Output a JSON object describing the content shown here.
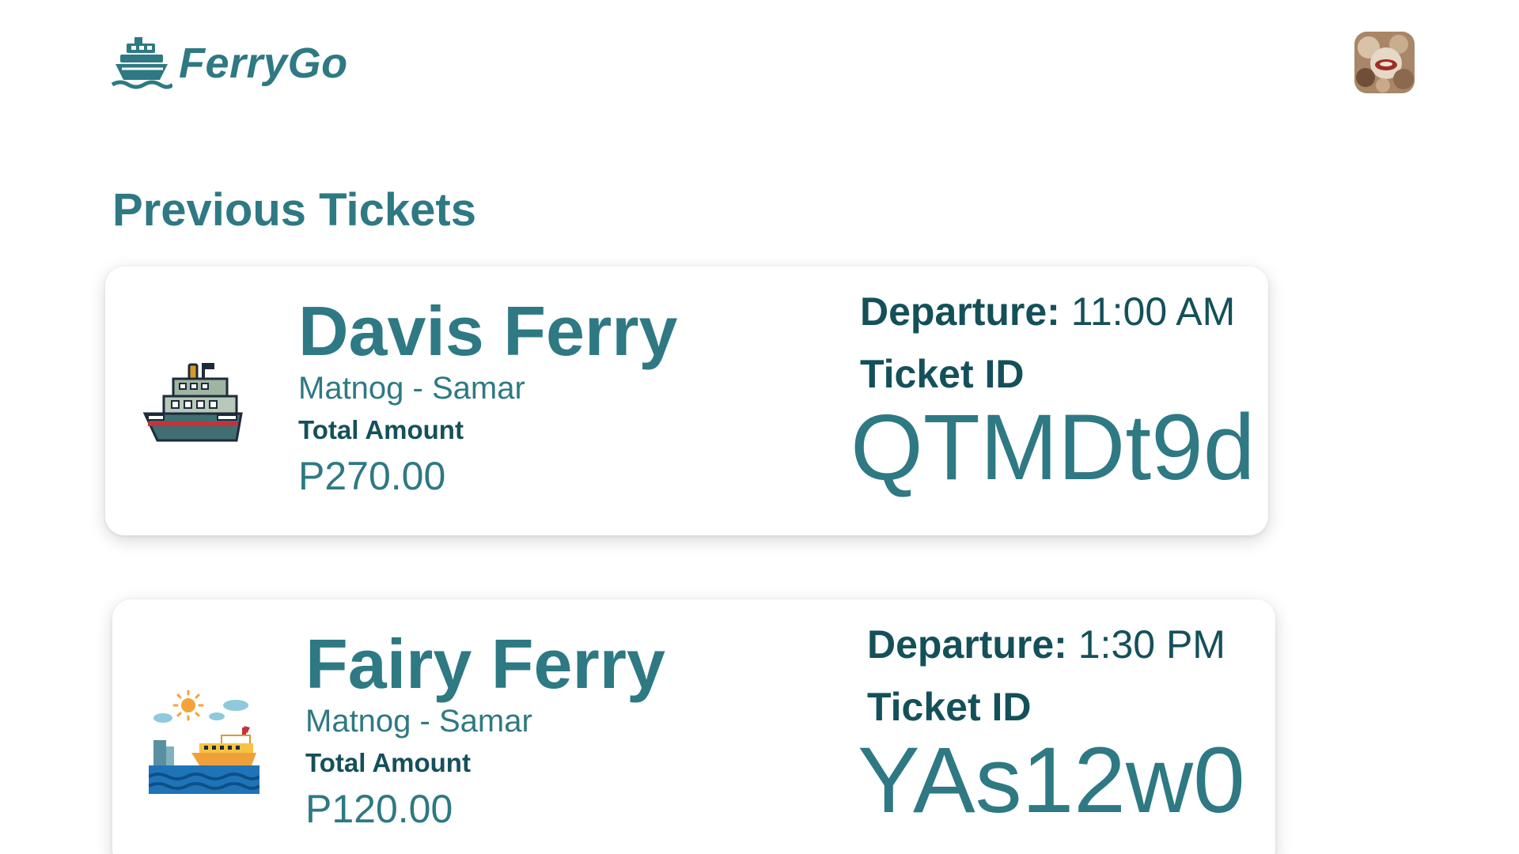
{
  "header": {
    "logo_text": "FerryGo",
    "logo_icon": "ship-logo-icon",
    "avatar_icon": "user-avatar"
  },
  "main": {
    "section_title": "Previous Tickets"
  },
  "tickets": [
    {
      "ferry_name": "Davis Ferry",
      "route": "Matnog - Samar",
      "total_amount_label": "Total Amount",
      "total_amount": "P270.00",
      "departure_label": "Departure:",
      "departure_time": "11:00 AM",
      "ticket_id_label": "Ticket ID",
      "ticket_id": "QTMDt9d",
      "image": "ferry-ship-icon"
    },
    {
      "ferry_name": "Fairy Ferry",
      "route": "Matnog - Samar",
      "total_amount_label": "Total Amount",
      "total_amount": "P120.00",
      "departure_label": "Departure:",
      "departure_time": "1:30 PM",
      "ticket_id_label": "Ticket ID",
      "ticket_id": "YAs12w0",
      "image": "cruise-ship-sea-icon"
    }
  ],
  "colors": {
    "primary": "#2e7983",
    "dark": "#14505a",
    "background": "#ffffff"
  }
}
